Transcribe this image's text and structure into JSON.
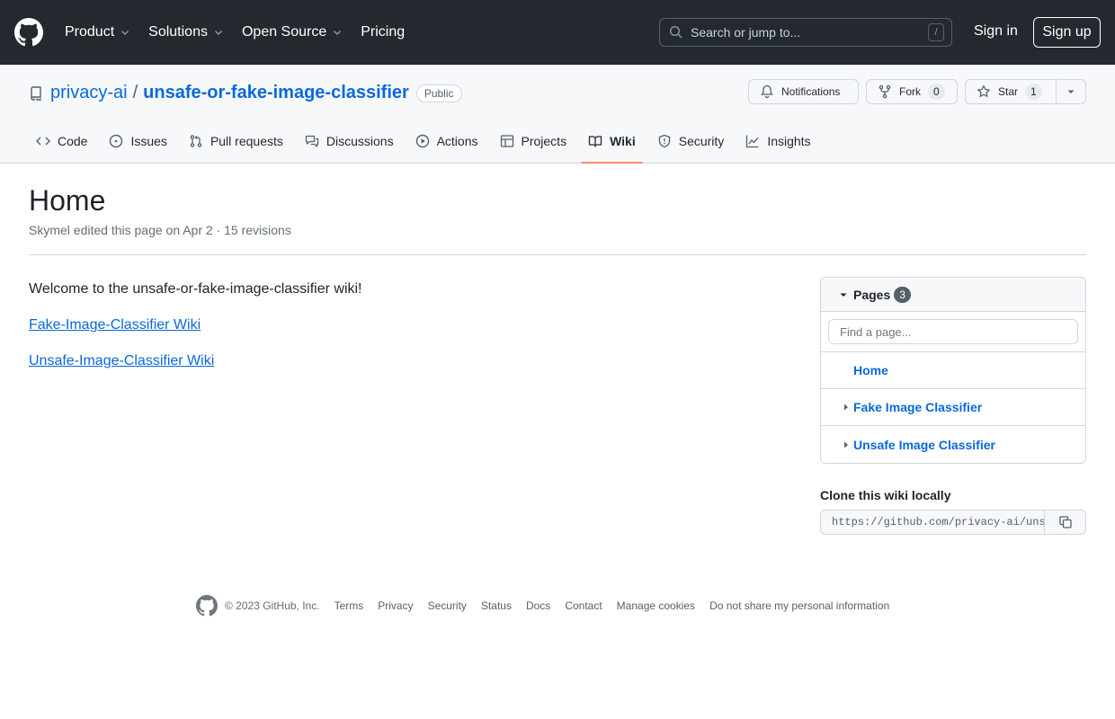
{
  "header": {
    "nav": [
      {
        "label": "Product"
      },
      {
        "label": "Solutions"
      },
      {
        "label": "Open Source"
      },
      {
        "label": "Pricing"
      }
    ],
    "search_placeholder": "Search or jump to...",
    "search_shortcut": "/",
    "sign_in": "Sign in",
    "sign_up": "Sign up"
  },
  "repo": {
    "owner": "privacy-ai",
    "separator": "/",
    "name": "unsafe-or-fake-image-classifier",
    "visibility": "Public",
    "notifications_label": "Notifications",
    "fork_label": "Fork",
    "fork_count": "0",
    "star_label": "Star",
    "star_count": "1"
  },
  "tabs": [
    {
      "label": "Code",
      "icon": "code-icon"
    },
    {
      "label": "Issues",
      "icon": "issue-icon"
    },
    {
      "label": "Pull requests",
      "icon": "pull-request-icon"
    },
    {
      "label": "Discussions",
      "icon": "discussion-icon"
    },
    {
      "label": "Actions",
      "icon": "play-icon"
    },
    {
      "label": "Projects",
      "icon": "table-icon"
    },
    {
      "label": "Wiki",
      "icon": "book-icon",
      "selected": true
    },
    {
      "label": "Security",
      "icon": "shield-icon"
    },
    {
      "label": "Insights",
      "icon": "graph-icon"
    }
  ],
  "page": {
    "title": "Home",
    "meta": "Skymel edited this page on Apr 2 · 15 revisions",
    "body": {
      "intro": "Welcome to the unsafe-or-fake-image-classifier wiki!",
      "links": [
        "Fake-Image-Classifier Wiki",
        "Unsafe-Image-Classifier Wiki"
      ]
    }
  },
  "sidebar": {
    "pages_label": "Pages",
    "pages_count": "3",
    "filter_placeholder": "Find a page...",
    "pages": [
      {
        "name": "Home",
        "expandable": false
      },
      {
        "name": "Fake Image Classifier",
        "expandable": true
      },
      {
        "name": "Unsafe Image Classifier",
        "expandable": true
      }
    ],
    "clone_label": "Clone this wiki locally",
    "clone_url": "https://github.com/privacy-ai/unsafe-or-fake-image-classifier.wiki.git"
  },
  "footer": {
    "copyright": "© 2023 GitHub, Inc.",
    "links": [
      "Terms",
      "Privacy",
      "Security",
      "Status",
      "Docs",
      "Contact",
      "Manage cookies",
      "Do not share my personal information"
    ]
  },
  "colors": {
    "header_bg": "#24292f",
    "link": "#0969da",
    "tab_underline": "#fd8c73"
  }
}
